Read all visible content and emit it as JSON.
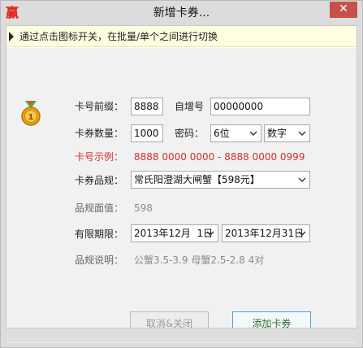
{
  "window": {
    "title": "新增卡券...",
    "app_icon_glyph": "赢",
    "close_glyph": "✕"
  },
  "hint": {
    "text": "通过点击图标开关，在批量/单个之间进行切换"
  },
  "form": {
    "prefix_label": "卡号前缀：",
    "prefix_value": "8888",
    "serial_label": "自增号",
    "serial_value": "00000000",
    "quantity_label": "卡券数量：",
    "quantity_value": "1000",
    "password_label": "密码：",
    "password_length": "6位",
    "password_type": "数字",
    "example_label": "卡号示例：",
    "example_value": "8888 0000 0000 - 8888 0000 0999",
    "spec_label": "卡券品规：",
    "spec_value": "常氏阳澄湖大闸蟹【598元】",
    "face_label": "品规面值：",
    "face_value": "598",
    "valid_label": "有限期限：",
    "valid_from": "2013年12月  1日",
    "valid_to": "2013年12月31日",
    "desc_label": "品规说明：",
    "desc_value": "公蟹3.5-3.9  母蟹2.5-2.8  4对"
  },
  "buttons": {
    "cancel_label": "取消&关闭",
    "add_label": "添加卡券"
  },
  "colors": {
    "accent_red": "#d03030",
    "close_red": "#c7504a",
    "primary_border": "#4aa3d8",
    "hint_bg": "#ffffe1"
  }
}
